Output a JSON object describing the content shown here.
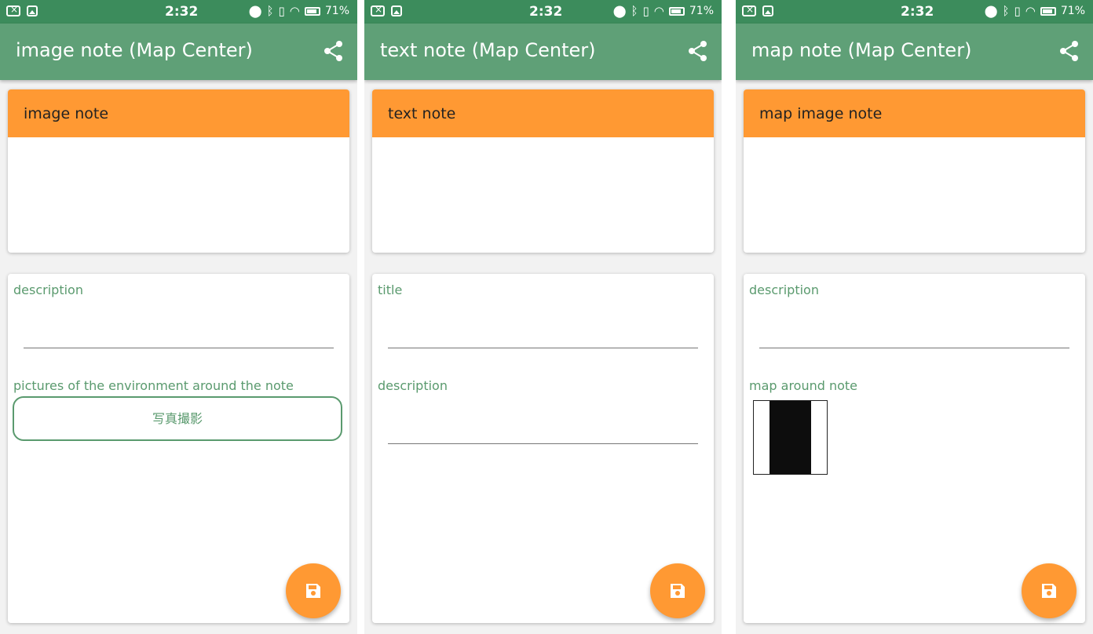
{
  "status_bar": {
    "time": "2:32",
    "battery": "71%"
  },
  "colors": {
    "status_bar": "#3c8c5c",
    "app_bar": "#5fa077",
    "accent": "#ff9933",
    "label": "#5a9a6e"
  },
  "screens": [
    {
      "app_title": "image note (Map Center)",
      "header": "image note",
      "fields": [
        {
          "label": "description"
        }
      ],
      "pictures_label": "pictures of the environment around the note",
      "photo_button_label": "写真撮影"
    },
    {
      "app_title": "text note (Map Center)",
      "header": "text note",
      "fields": [
        {
          "label": "title"
        },
        {
          "label": "description"
        }
      ]
    },
    {
      "app_title": "map note (Map Center)",
      "header": "map image note",
      "fields": [
        {
          "label": "description"
        }
      ],
      "map_label": "map around note"
    }
  ]
}
